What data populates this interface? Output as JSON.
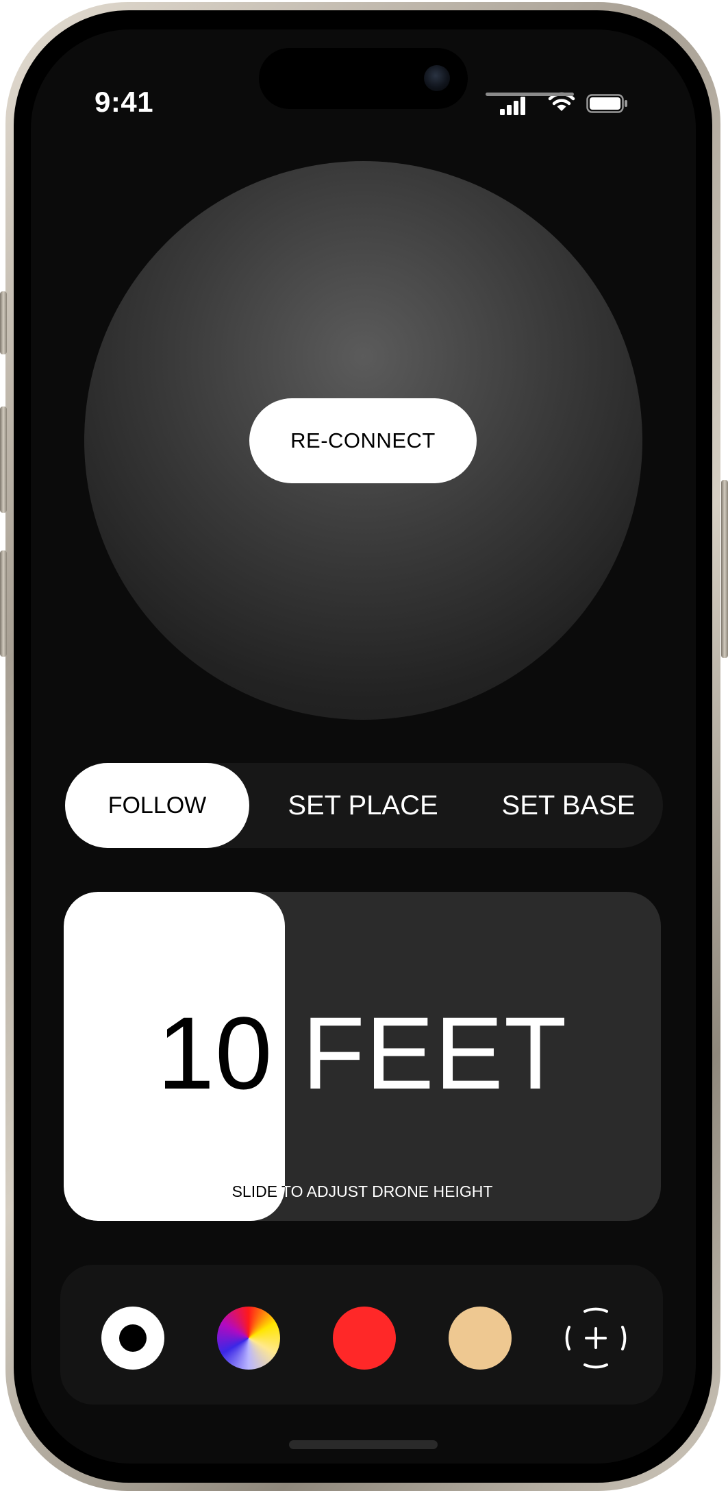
{
  "status_bar": {
    "time": "9:41"
  },
  "connection": {
    "reconnect_label": "RE-CONNECT"
  },
  "modes": [
    {
      "label": "FOLLOW",
      "selected": true
    },
    {
      "label": "SET PLACE",
      "selected": false
    },
    {
      "label": "SET BASE",
      "selected": false
    }
  ],
  "height_slider": {
    "value_label": "10 FEET",
    "hint": "SLIDE TO ADJUST DRONE HEIGHT",
    "fill_fraction": 0.37
  },
  "color_options": [
    {
      "name": "ring-swatch",
      "icon": "ring-icon",
      "color": "#ffffff",
      "selected": true
    },
    {
      "name": "multicolor-swatch",
      "icon": "color-wheel-icon",
      "color": "multicolor"
    },
    {
      "name": "red-swatch",
      "color": "#ff2828"
    },
    {
      "name": "sand-swatch",
      "color": "#eec891"
    },
    {
      "name": "add-color-button",
      "icon": "add-target-icon"
    }
  ],
  "colors": {
    "screen_bg": "#0b0b0b",
    "accent_white": "#ffffff",
    "card_bg": "#2b2b2b"
  }
}
